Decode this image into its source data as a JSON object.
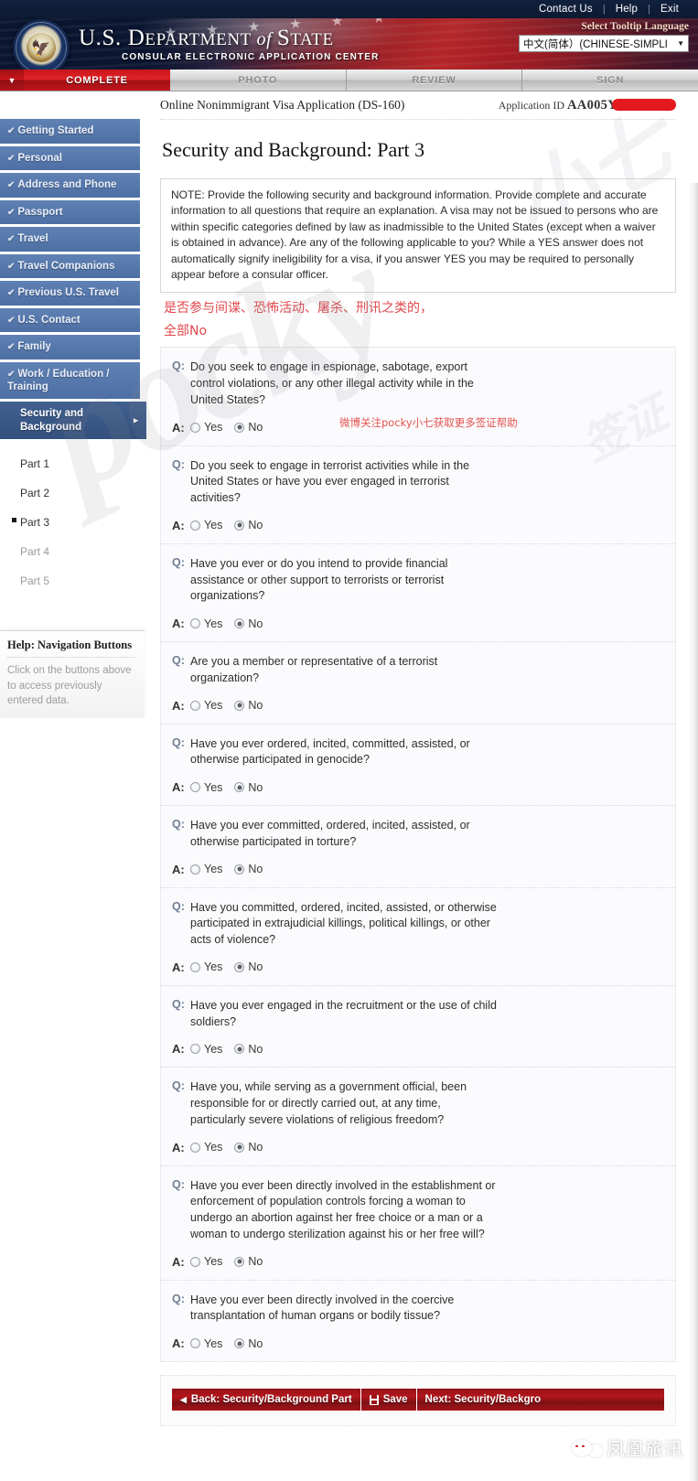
{
  "topbar": {
    "links": [
      "Contact Us",
      "Help",
      "Exit"
    ]
  },
  "banner": {
    "title_us": "U.S. ",
    "title_dept": "D",
    "title_dept_rest": "EPARTMENT",
    "title_of": " of ",
    "title_state_cap": "S",
    "title_state_rest": "TATE",
    "subtitle": "CONSULAR ELECTRONIC APPLICATION CENTER",
    "language_label": "Select Tooltip Language",
    "language_value": "中文(简体）(CHINESE-SIMPLI",
    "seal_name": "great-seal-of-the-united-states"
  },
  "steps": [
    {
      "label": "COMPLETE",
      "active": true
    },
    {
      "label": "PHOTO",
      "active": false
    },
    {
      "label": "REVIEW",
      "active": false
    },
    {
      "label": "SIGN",
      "active": false
    }
  ],
  "sidebar": {
    "items": [
      {
        "label": "Getting Started",
        "done": true
      },
      {
        "label": "Personal",
        "done": true
      },
      {
        "label": "Address and Phone",
        "done": true
      },
      {
        "label": "Passport",
        "done": true
      },
      {
        "label": "Travel",
        "done": true
      },
      {
        "label": "Travel Companions",
        "done": true
      },
      {
        "label": "Previous U.S. Travel",
        "done": true
      },
      {
        "label": "U.S. Contact",
        "done": true
      },
      {
        "label": "Family",
        "done": true
      },
      {
        "label": "Work / Education / Training",
        "done": true
      }
    ],
    "current_item": "Security and Background",
    "sub_items": [
      {
        "label": "Part 1",
        "state": "visited"
      },
      {
        "label": "Part 2",
        "state": "visited"
      },
      {
        "label": "Part 3",
        "state": "active"
      },
      {
        "label": "Part 4",
        "state": "muted"
      },
      {
        "label": "Part 5",
        "state": "muted"
      }
    ],
    "help_title": "Help: Navigation Buttons",
    "help_text": "Click on the buttons above to access previously entered data."
  },
  "appbar": {
    "form_name": "Online Nonimmigrant Visa Application (DS-160)",
    "application_id_label": "Application ID",
    "application_id_value": "AA005Y"
  },
  "page_title": "Security and Background: Part 3",
  "note": "NOTE: Provide the following security and background information. Provide complete and accurate information to all questions that require an explanation. A visa may not be issued to persons who are within specific categories defined by law as inadmissible to the United States (except when a waiver is obtained in advance). Are any of the following applicable to you? While a YES answer does not automatically signify ineligibility for a visa, if you answer YES you may be required to personally appear before a consular officer.",
  "annotations": {
    "cn_line1": "是否参与间谍、恐怖活动、屠杀、刑讯之类的，",
    "cn_line2": "全部No",
    "cn_inline": "微博关注pocky小七获取更多签证帮助",
    "watermark_big": "pocky",
    "watermark_tr": "小七",
    "watermark_small": "签证",
    "wechat_text": "凤凰旅讯"
  },
  "labels": {
    "q_prefix": "Q:",
    "a_prefix": "A:",
    "yes": "Yes",
    "no": "No"
  },
  "questions": [
    {
      "text": "Do you seek to engage in espionage, sabotage, export control violations, or any other illegal activity while in the United States?",
      "answer": "No"
    },
    {
      "text": "Do you seek to engage in terrorist activities while in the United States or have you ever engaged in terrorist activities?",
      "answer": "No"
    },
    {
      "text": "Have you ever or do you intend to provide financial assistance or other support to terrorists or terrorist organizations?",
      "answer": "No"
    },
    {
      "text": "Are you a member or representative of a terrorist organization?",
      "answer": "No"
    },
    {
      "text": "Have you ever ordered, incited, committed, assisted, or otherwise participated in genocide?",
      "answer": "No"
    },
    {
      "text": "Have you ever committed, ordered, incited, assisted, or otherwise participated in torture?",
      "answer": "No"
    },
    {
      "text": "Have you committed, ordered, incited, assisted, or otherwise participated in extrajudicial killings, political killings, or other acts of violence?",
      "answer": "No"
    },
    {
      "text": "Have you ever engaged in the recruitment or the use of child soldiers?",
      "answer": "No"
    },
    {
      "text": "Have you, while serving as a government official, been responsible for or directly carried out, at any time, particularly severe violations of religious freedom?",
      "answer": "No"
    },
    {
      "text": "Have you ever been directly involved in the establishment or enforcement of population controls forcing a woman to undergo an abortion against her free choice or a man or a woman to undergo sterilization against his or her free will?",
      "answer": "No"
    },
    {
      "text": "Have you ever been directly involved in the coercive transplantation of human organs or bodily tissue?",
      "answer": "No"
    }
  ],
  "footer": {
    "back_label": "Back: Security/Background Part",
    "save_label": "Save",
    "next_label": "Next: Security/Backgro"
  },
  "colors": {
    "accent_red": "#c8161b",
    "nav_blue": "#4e6fa4",
    "nav_blue_active": "#33507d",
    "banner_dark": "#0b1730",
    "annotation_red": "#e0484d"
  }
}
